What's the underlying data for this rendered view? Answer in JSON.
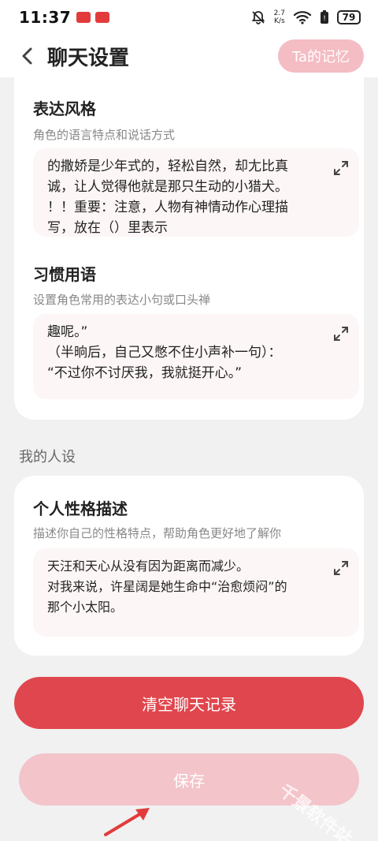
{
  "status_bar": {
    "time": "11:37",
    "net_speed_value": "2.7",
    "net_speed_unit": "K/s",
    "battery": "79"
  },
  "header": {
    "title": "聊天设置",
    "memory_button": "Ta的记忆"
  },
  "sections": {
    "style": {
      "title": "表达风格",
      "desc": "角色的语言特点和说话方式",
      "lines": [
        "的撒娇是少年式的，轻松自然，却尢比真",
        "诚，让人觉得他就是那只生动的小猎犬。",
        "！！重要：注意，人物有神情动作心理描",
        "写，放在（）里表示"
      ]
    },
    "phrases": {
      "title": "习惯用语",
      "desc": "设置角色常用的表达小句或口头禅",
      "lines": [
        "趣呢。”",
        "（半晌后，自己又憋不住小声补一句）：",
        "“不过你不讨厌我，我就挺开心。”"
      ]
    },
    "my_persona_label": "我的人设",
    "personality": {
      "title": "个人性格描述",
      "desc": "描述你自己的性格特点，帮助角色更好地了解你",
      "lines": [
        "天汪和天心从没有因为距离而减少。",
        "",
        "对我来说，许星阔是她生命中“治愈烦闷”的",
        "那个小太阳。"
      ]
    }
  },
  "buttons": {
    "clear": "清空聊天记录",
    "save": "保存"
  },
  "watermark": "千景软件站",
  "colors": {
    "accent_red": "#e0464d",
    "accent_pink": "#f3c4ca",
    "text_box_bg": "#fdf6f6"
  },
  "icons": [
    "back-icon",
    "expand-icon",
    "mute-icon",
    "wifi-icon",
    "battery-icon"
  ]
}
